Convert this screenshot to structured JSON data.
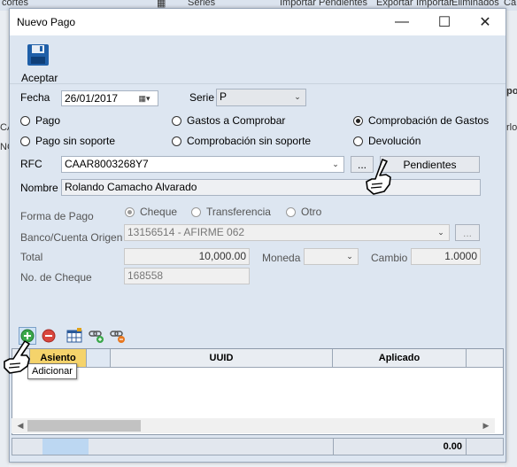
{
  "background": {
    "tabs": [
      "cortes",
      "Series",
      "Importar Pendientes",
      "Exportar",
      "Importar",
      "Eliminados",
      "Ca"
    ],
    "left_fragments": [
      "CA",
      "NC"
    ],
    "right_fragments": [
      "po",
      "rlo"
    ]
  },
  "window": {
    "title": "Nuevo Pago",
    "minimize_glyph": "—",
    "maximize_glyph": "☐",
    "close_glyph": "✕"
  },
  "toolbar": {
    "accept_label": "Aceptar"
  },
  "form": {
    "fecha_label": "Fecha",
    "fecha_value": "26/01/2017",
    "serie_label": "Serie",
    "serie_value": "P",
    "radios": [
      {
        "label": "Pago",
        "checked": false
      },
      {
        "label": "Gastos a Comprobar",
        "checked": false
      },
      {
        "label": "Comprobación de Gastos",
        "checked": true
      },
      {
        "label": "Pago sin soporte",
        "checked": false
      },
      {
        "label": "Comprobación sin soporte",
        "checked": false
      },
      {
        "label": "Devolución",
        "checked": false
      }
    ],
    "rfc_label": "RFC",
    "rfc_value": "CAAR8003268Y7",
    "ellipsis_label": "...",
    "pendientes_label": "Pendientes",
    "nombre_label": "Nombre",
    "nombre_value": "Rolando Camacho Alvarado",
    "forma_pago_label": "Forma de Pago",
    "forma_options": [
      {
        "label": "Cheque",
        "checked": true
      },
      {
        "label": "Transferencia",
        "checked": false
      },
      {
        "label": "Otro",
        "checked": false
      }
    ],
    "banco_label": "Banco/Cuenta Origen",
    "banco_value": "13156514 - AFIRME  062",
    "total_label": "Total",
    "total_value": "10,000.00",
    "moneda_label": "Moneda",
    "moneda_value": "",
    "cambio_label": "Cambio",
    "cambio_value": "1.0000",
    "cheque_label": "No. de Cheque",
    "cheque_value": "168558"
  },
  "grid": {
    "columns": [
      "Asiento",
      "UUID",
      "Aplicado"
    ],
    "total": "0.00"
  },
  "tooltip": "Adicionar",
  "colors": {
    "window_bg": "#dde6f1",
    "asiento_header": "#f5d36b",
    "add_green": "#3aa84a",
    "remove_red": "#d9463e"
  }
}
